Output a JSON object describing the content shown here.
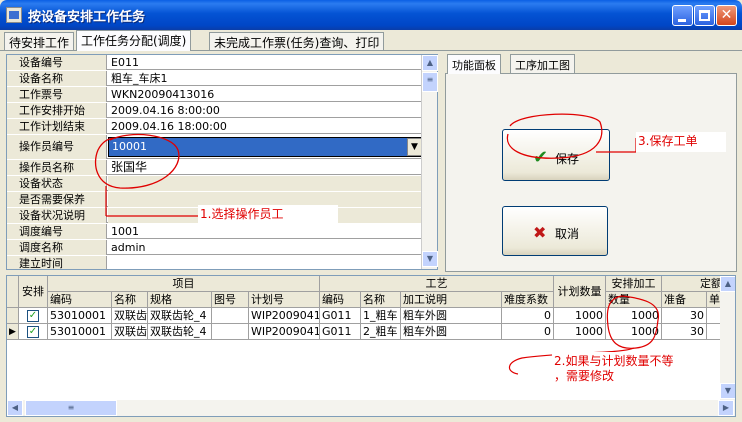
{
  "window": {
    "title": "按设备安排工作任务"
  },
  "tabs": [
    "待安排工作",
    "工作任务分配(调度)",
    "未完成工作票(任务)查询、打印"
  ],
  "properties": [
    {
      "label": "设备编号",
      "value": "E011"
    },
    {
      "label": "设备名称",
      "value": "粗车_车床1"
    },
    {
      "label": "工作票号",
      "value": "WKN20090413016"
    },
    {
      "label": "工作安排开始",
      "value": "2009.04.16 8:00:00"
    },
    {
      "label": "工作计划结束",
      "value": "2009.04.16 18:00:00"
    },
    {
      "label": "操作员编号",
      "value": "10001"
    },
    {
      "label": "操作员名称",
      "value": "张国华"
    },
    {
      "label": "设备状态",
      "value": ""
    },
    {
      "label": "是否需要保养",
      "value": ""
    },
    {
      "label": "设备状况说明",
      "value": ""
    },
    {
      "label": "调度编号",
      "value": "1001"
    },
    {
      "label": "调度名称",
      "value": "admin"
    },
    {
      "label": "建立时间",
      "value": ""
    }
  ],
  "right_panel": {
    "tabs": [
      "功能面板",
      "工序加工图"
    ],
    "save_label": "保存",
    "cancel_label": "取消"
  },
  "annotations": {
    "a1": "1.选择操作员工",
    "a2_line1": "2.如果与计划数量不等",
    "a2_line2": "，需要修改",
    "a3": "3.保存工单"
  },
  "table": {
    "groups": {
      "project": "项目",
      "process": "工艺",
      "plan_qty": "计划数量",
      "assign_qty": "安排加工",
      "fixed": "定额"
    },
    "headers": [
      "安排",
      "编码",
      "名称",
      "规格",
      "图号",
      "计划号",
      "编码",
      "名称",
      "加工说明",
      "难度系数",
      "计划数量",
      "数量",
      "准备",
      "单"
    ],
    "rows": [
      {
        "checked": true,
        "code": "53010001",
        "name": "双联齿",
        "spec": "双联齿轮_4",
        "drawing": "",
        "plan_no": "WIP20090413",
        "proc_code": "G011",
        "proc_name": "1_粗车",
        "desc": "粗车外圆",
        "difficulty": "0",
        "plan_qty": "1000",
        "qty": "1000",
        "prep": "30"
      },
      {
        "checked": true,
        "code": "53010001",
        "name": "双联齿",
        "spec": "双联齿轮_4",
        "drawing": "",
        "plan_no": "WIP20090413",
        "proc_code": "G011",
        "proc_name": "2_粗车",
        "desc": "粗车外圆",
        "difficulty": "0",
        "plan_qty": "1000",
        "qty": "1000",
        "prep": "30"
      }
    ]
  },
  "colors": {
    "annotation": "#e00000",
    "selection": "#316ac5",
    "titlebar": "#0453d4"
  }
}
